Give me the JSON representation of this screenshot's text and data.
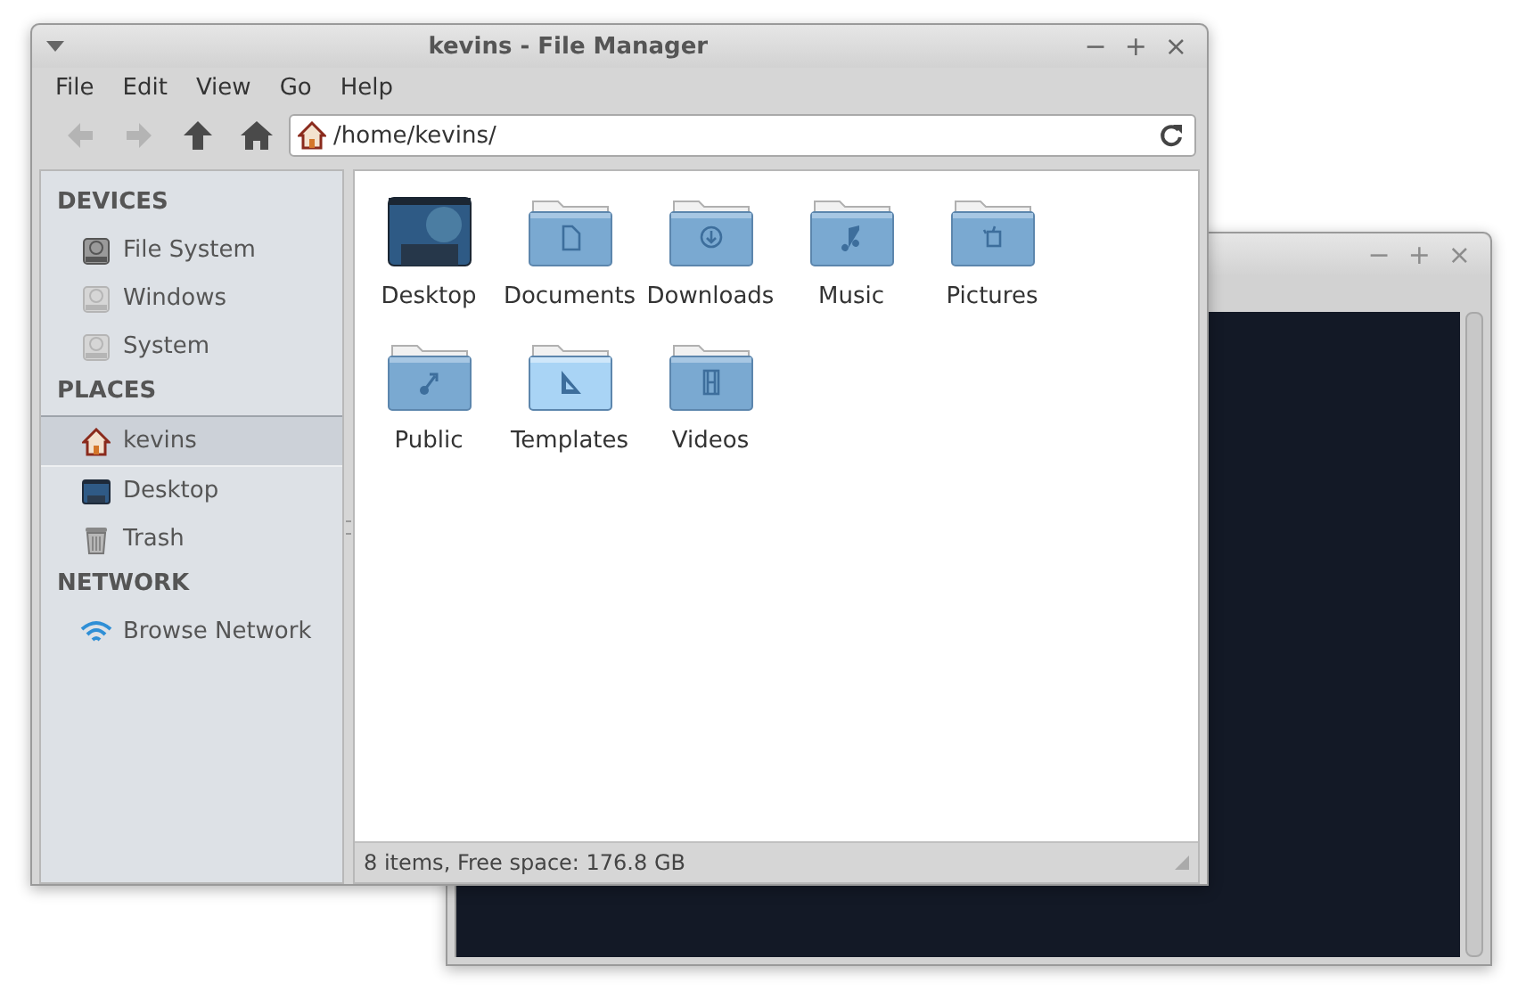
{
  "background_window": {
    "controls": [
      "−",
      "+",
      "×"
    ]
  },
  "window": {
    "title": "kevins - File Manager",
    "controls": [
      "−",
      "+",
      "×"
    ]
  },
  "menu": [
    "File",
    "Edit",
    "View",
    "Go",
    "Help"
  ],
  "toolbar": [
    {
      "kind": "back",
      "disabled": true
    },
    {
      "kind": "forward",
      "disabled": true
    },
    {
      "kind": "up",
      "disabled": false
    },
    {
      "kind": "home",
      "disabled": false
    }
  ],
  "location": {
    "value": "/home/kevins/"
  },
  "sidebar": {
    "sections": [
      {
        "title": "DEVICES",
        "items": [
          {
            "label": "File System",
            "kind": "drive",
            "mounted": true,
            "selected": false
          },
          {
            "label": "Windows",
            "kind": "drive",
            "mounted": false,
            "selected": false
          },
          {
            "label": "System",
            "kind": "drive",
            "mounted": false,
            "selected": false
          }
        ]
      },
      {
        "title": "PLACES",
        "items": [
          {
            "label": "kevins",
            "kind": "home",
            "selected": true
          },
          {
            "label": "Desktop",
            "kind": "desktop",
            "selected": false
          },
          {
            "label": "Trash",
            "kind": "trash",
            "selected": false
          }
        ]
      },
      {
        "title": "NETWORK",
        "items": [
          {
            "label": "Browse Network",
            "kind": "network",
            "selected": false
          }
        ]
      }
    ]
  },
  "files": [
    {
      "label": "Desktop",
      "kind": "desktop",
      "highlighted": false
    },
    {
      "label": "Documents",
      "kind": "document",
      "highlighted": false
    },
    {
      "label": "Downloads",
      "kind": "download",
      "highlighted": false
    },
    {
      "label": "Music",
      "kind": "music",
      "highlighted": false
    },
    {
      "label": "Pictures",
      "kind": "picture",
      "highlighted": false
    },
    {
      "label": "Public",
      "kind": "share",
      "highlighted": false
    },
    {
      "label": "Templates",
      "kind": "template",
      "highlighted": true
    },
    {
      "label": "Videos",
      "kind": "video",
      "highlighted": false
    }
  ],
  "status_bar": "8 items, Free space: 176.8 GB"
}
